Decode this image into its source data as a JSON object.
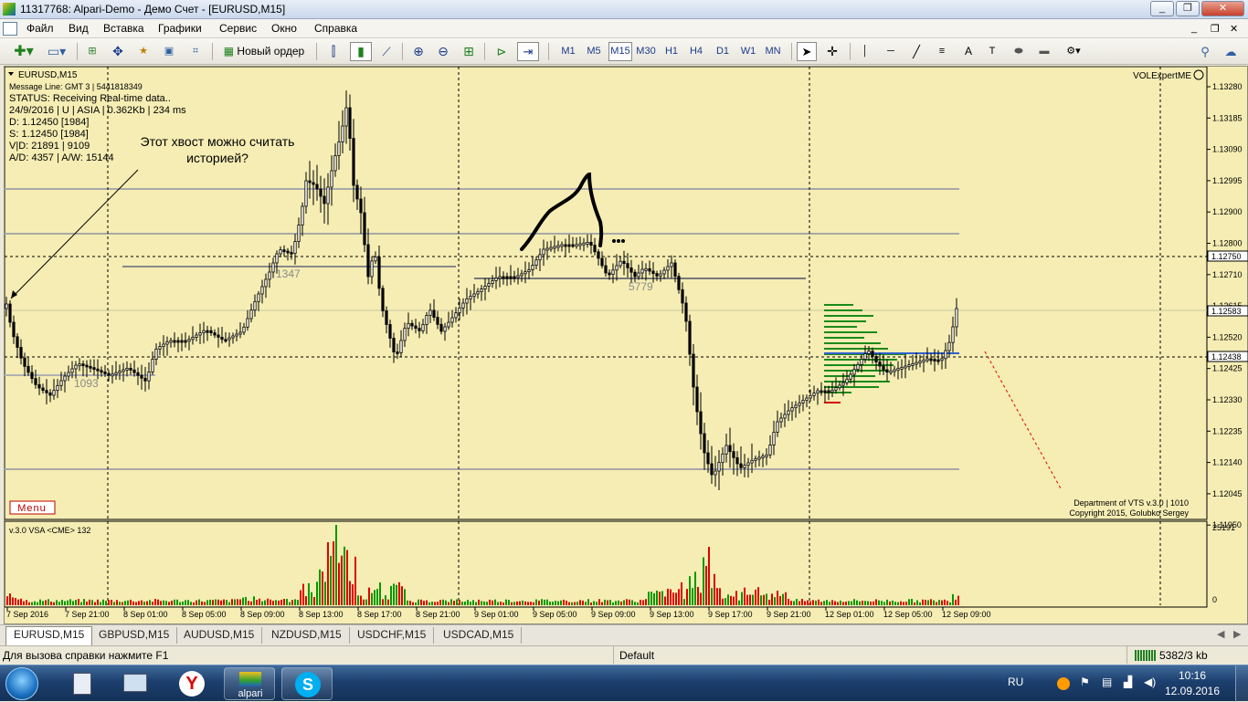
{
  "window": {
    "title": "11317768: Alpari-Demo - Демо Счет - [EURUSD,M15]",
    "controls": {
      "minimize": "_",
      "restore": "❐",
      "close": "✕"
    },
    "inner_controls": {
      "minimize": "_",
      "restore": "❐",
      "close": "✕"
    }
  },
  "menu": [
    "Файл",
    "Вид",
    "Вставка",
    "Графики",
    "Сервис",
    "Окно",
    "Справка"
  ],
  "toolbar": {
    "new_order": "Новый ордер",
    "timeframes": [
      "M1",
      "M5",
      "M15",
      "M30",
      "H1",
      "H4",
      "D1",
      "W1",
      "MN"
    ],
    "active_timeframe": "M15",
    "text_tool": "A"
  },
  "chart": {
    "symbol_label": "EURUSD,M15",
    "info_lines": [
      "Message Line: GMT 3 | 5441818349",
      "STATUS:  Receiving Real-time data..",
      "24/9/2016 | U | ASIA | 0.362Kb | 234 ms",
      "D: 1.12450  [1984]",
      "S: 1.12450  [1984]",
      "V|D: 21891 | 9109",
      "A/D: 4357 | A/W: 15144"
    ],
    "annotation": [
      "Этот хвост можно считать",
      "историей?"
    ],
    "expert_label": "VOLExpertME",
    "menu_button": "Menu",
    "copyright": [
      "Department of VTS  v.3.0 | 1010",
      "Copyright 2015, Golubko Sergey"
    ],
    "price_labels": [
      "1.13280",
      "1.13185",
      "1.13090",
      "1.12995",
      "1.12900",
      "1.12800",
      "1.12710",
      "1.12615",
      "1.12520",
      "1.12425",
      "1.12330",
      "1.12235",
      "1.12140",
      "1.12045",
      "1.11950"
    ],
    "highlight_prices": {
      "ask": "1.12750",
      "current": "1.12583",
      "bid": "1.12438"
    },
    "level_labels": [
      "1347",
      "5779",
      "1093"
    ],
    "time_labels": [
      "7 Sep 2016",
      "7 Sep 21:00",
      "8 Sep 01:00",
      "8 Sep 05:00",
      "8 Sep 09:00",
      "8 Sep 13:00",
      "8 Sep 17:00",
      "8 Sep 21:00",
      "9 Sep 01:00",
      "9 Sep 05:00",
      "9 Sep 09:00",
      "9 Sep 13:00",
      "9 Sep 17:00",
      "9 Sep 21:00",
      "12 Sep 01:00",
      "12 Sep 05:00",
      "12 Sep 09:00"
    ],
    "volume_title": "v.3.0 VSA <CME> 132",
    "volume_scale": {
      "max": "25191",
      "min": "0"
    },
    "colors": {
      "background": "#f5edb3",
      "candles": "#000000",
      "volume_up": "#009900",
      "volume_down": "#e00000",
      "levels": "#a8a8a8",
      "highlight": "#ffffff"
    }
  },
  "symbol_tabs": [
    "EURUSD,M15",
    "GBPUSD,M15",
    "AUDUSD,M15",
    "NZDUSD,M15",
    "USDCHF,M15",
    "USDCAD,M15"
  ],
  "active_tab": "EURUSD,M15",
  "status": {
    "help": "Для вызова справки нажмите F1",
    "profile": "Default",
    "traffic": "5382/3 kb"
  },
  "taskbar": {
    "lang": "RU",
    "time": "10:16",
    "date": "12.09.2016",
    "alpari_label": "alpari"
  }
}
